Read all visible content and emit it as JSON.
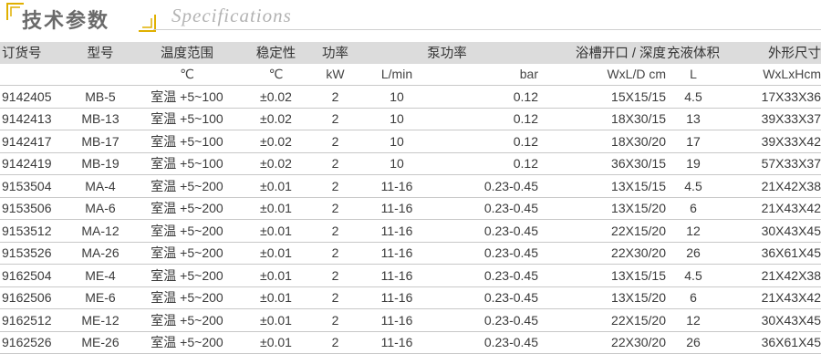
{
  "header": {
    "title_zh": "技术参数",
    "title_en": "Specifications"
  },
  "columns": [
    "订货号",
    "型号",
    "温度范围",
    "稳定性",
    "功率",
    "泵功率",
    "浴槽开口 / 深度",
    "充液体积",
    "外形尺寸"
  ],
  "units": {
    "temp": "℃",
    "stability": "℃",
    "power": "kW",
    "pump_flow": "L/min",
    "pump_pressure": "bar",
    "bath": "WxL/D cm",
    "volume": "L",
    "dims": "WxLxHcm"
  },
  "rows": [
    {
      "order": "9142405",
      "model": "MB-5",
      "temp": "室温 +5~100",
      "stability": "±0.02",
      "power": "2",
      "flow": "10",
      "pressure": "0.12",
      "bath": "15X15/15",
      "volume": "4.5",
      "dims": "17X33X36"
    },
    {
      "order": "9142413",
      "model": "MB-13",
      "temp": "室温 +5~100",
      "stability": "±0.02",
      "power": "2",
      "flow": "10",
      "pressure": "0.12",
      "bath": "18X30/15",
      "volume": "13",
      "dims": "39X33X37"
    },
    {
      "order": "9142417",
      "model": "MB-17",
      "temp": "室温 +5~100",
      "stability": "±0.02",
      "power": "2",
      "flow": "10",
      "pressure": "0.12",
      "bath": "18X30/20",
      "volume": "17",
      "dims": "39X33X42"
    },
    {
      "order": "9142419",
      "model": "MB-19",
      "temp": "室温 +5~100",
      "stability": "±0.02",
      "power": "2",
      "flow": "10",
      "pressure": "0.12",
      "bath": "36X30/15",
      "volume": "19",
      "dims": "57X33X37"
    },
    {
      "order": "9153504",
      "model": "MA-4",
      "temp": "室温 +5~200",
      "stability": "±0.01",
      "power": "2",
      "flow": "11-16",
      "pressure": "0.23-0.45",
      "bath": "13X15/15",
      "volume": "4.5",
      "dims": "21X42X38"
    },
    {
      "order": "9153506",
      "model": "MA-6",
      "temp": "室温 +5~200",
      "stability": "±0.01",
      "power": "2",
      "flow": "11-16",
      "pressure": "0.23-0.45",
      "bath": "13X15/20",
      "volume": "6",
      "dims": "21X43X42"
    },
    {
      "order": "9153512",
      "model": "MA-12",
      "temp": "室温 +5~200",
      "stability": "±0.01",
      "power": "2",
      "flow": "11-16",
      "pressure": "0.23-0.45",
      "bath": "22X15/20",
      "volume": "12",
      "dims": "30X43X45"
    },
    {
      "order": "9153526",
      "model": "MA-26",
      "temp": "室温 +5~200",
      "stability": "±0.01",
      "power": "2",
      "flow": "11-16",
      "pressure": "0.23-0.45",
      "bath": "22X30/20",
      "volume": "26",
      "dims": "36X61X45"
    },
    {
      "order": "9162504",
      "model": "ME-4",
      "temp": "室温 +5~200",
      "stability": "±0.01",
      "power": "2",
      "flow": "11-16",
      "pressure": "0.23-0.45",
      "bath": "13X15/15",
      "volume": "4.5",
      "dims": "21X42X38"
    },
    {
      "order": "9162506",
      "model": "ME-6",
      "temp": "室温 +5~200",
      "stability": "±0.01",
      "power": "2",
      "flow": "11-16",
      "pressure": "0.23-0.45",
      "bath": "13X15/20",
      "volume": "6",
      "dims": "21X43X42"
    },
    {
      "order": "9162512",
      "model": "ME-12",
      "temp": "室温 +5~200",
      "stability": "±0.01",
      "power": "2",
      "flow": "11-16",
      "pressure": "0.23-0.45",
      "bath": "22X15/20",
      "volume": "12",
      "dims": "30X43X45"
    },
    {
      "order": "9162526",
      "model": "ME-26",
      "temp": "室温 +5~200",
      "stability": "±0.01",
      "power": "2",
      "flow": "11-16",
      "pressure": "0.23-0.45",
      "bath": "22X30/20",
      "volume": "26",
      "dims": "36X61X45"
    }
  ]
}
